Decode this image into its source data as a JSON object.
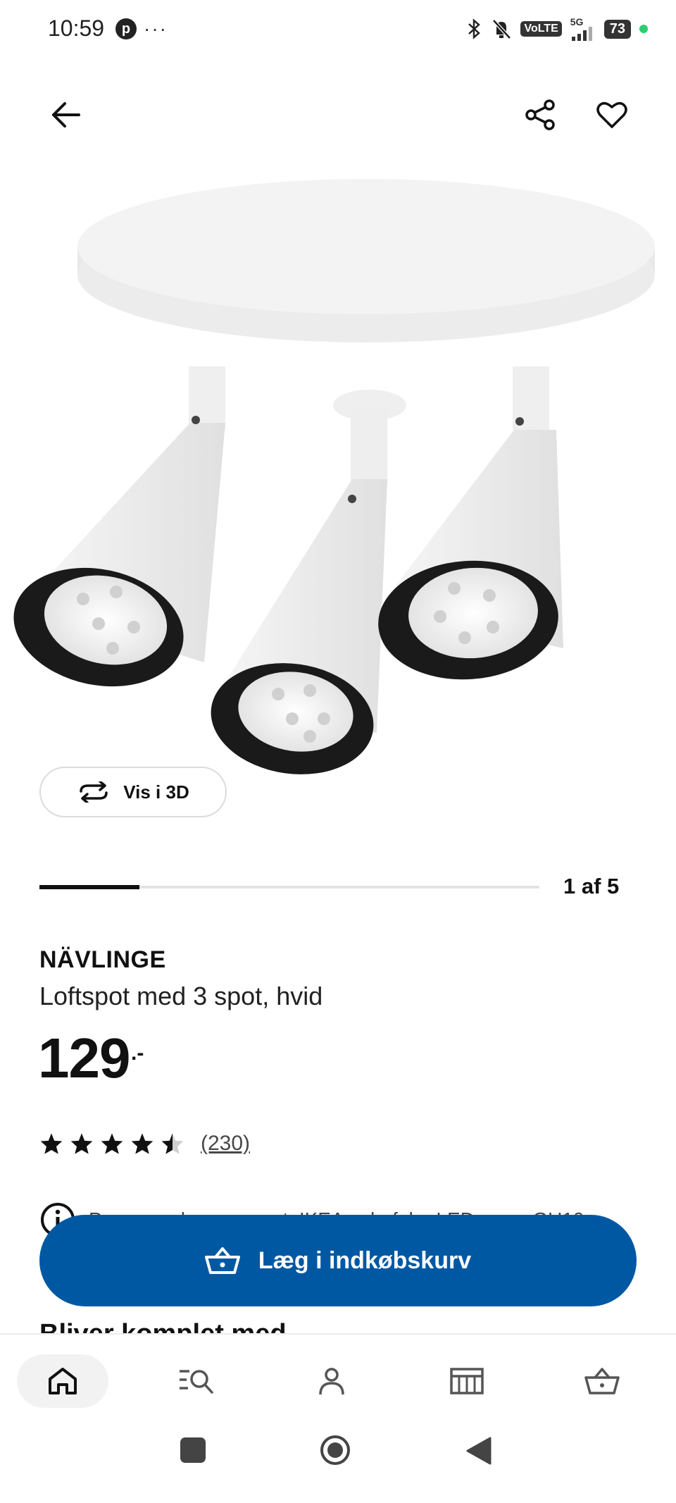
{
  "status_bar": {
    "time": "10:59",
    "pinterest_letter": "p",
    "overflow": "···",
    "network_badge_a": "VoLTE",
    "network_label": "5G",
    "battery": "73"
  },
  "top_bar": {
    "back_icon": "arrow-left-icon",
    "share_icon": "share-icon",
    "favorite_icon": "heart-icon"
  },
  "media": {
    "view_3d_label": "Vis i 3D",
    "counter": "1 af 5",
    "progress_fraction": 0.2
  },
  "product": {
    "brand": "NÄVLINGE",
    "description": "Loftspot med 3 spot, hvid",
    "price": "129",
    "price_suffix": ".-",
    "rating_stars": 4.5,
    "rating_count": "(230)",
    "info_text": "Pæren sælges separat. IKEA anbefaler LED-pære GU10"
  },
  "cart_button": {
    "label": "Læg i indkøbskurv",
    "color": "#0058a3"
  },
  "section": {
    "heading": "Bliver komplet med"
  },
  "bottom_nav": [
    "home-icon",
    "search-icon",
    "profile-icon",
    "store-icon",
    "cart-icon"
  ]
}
